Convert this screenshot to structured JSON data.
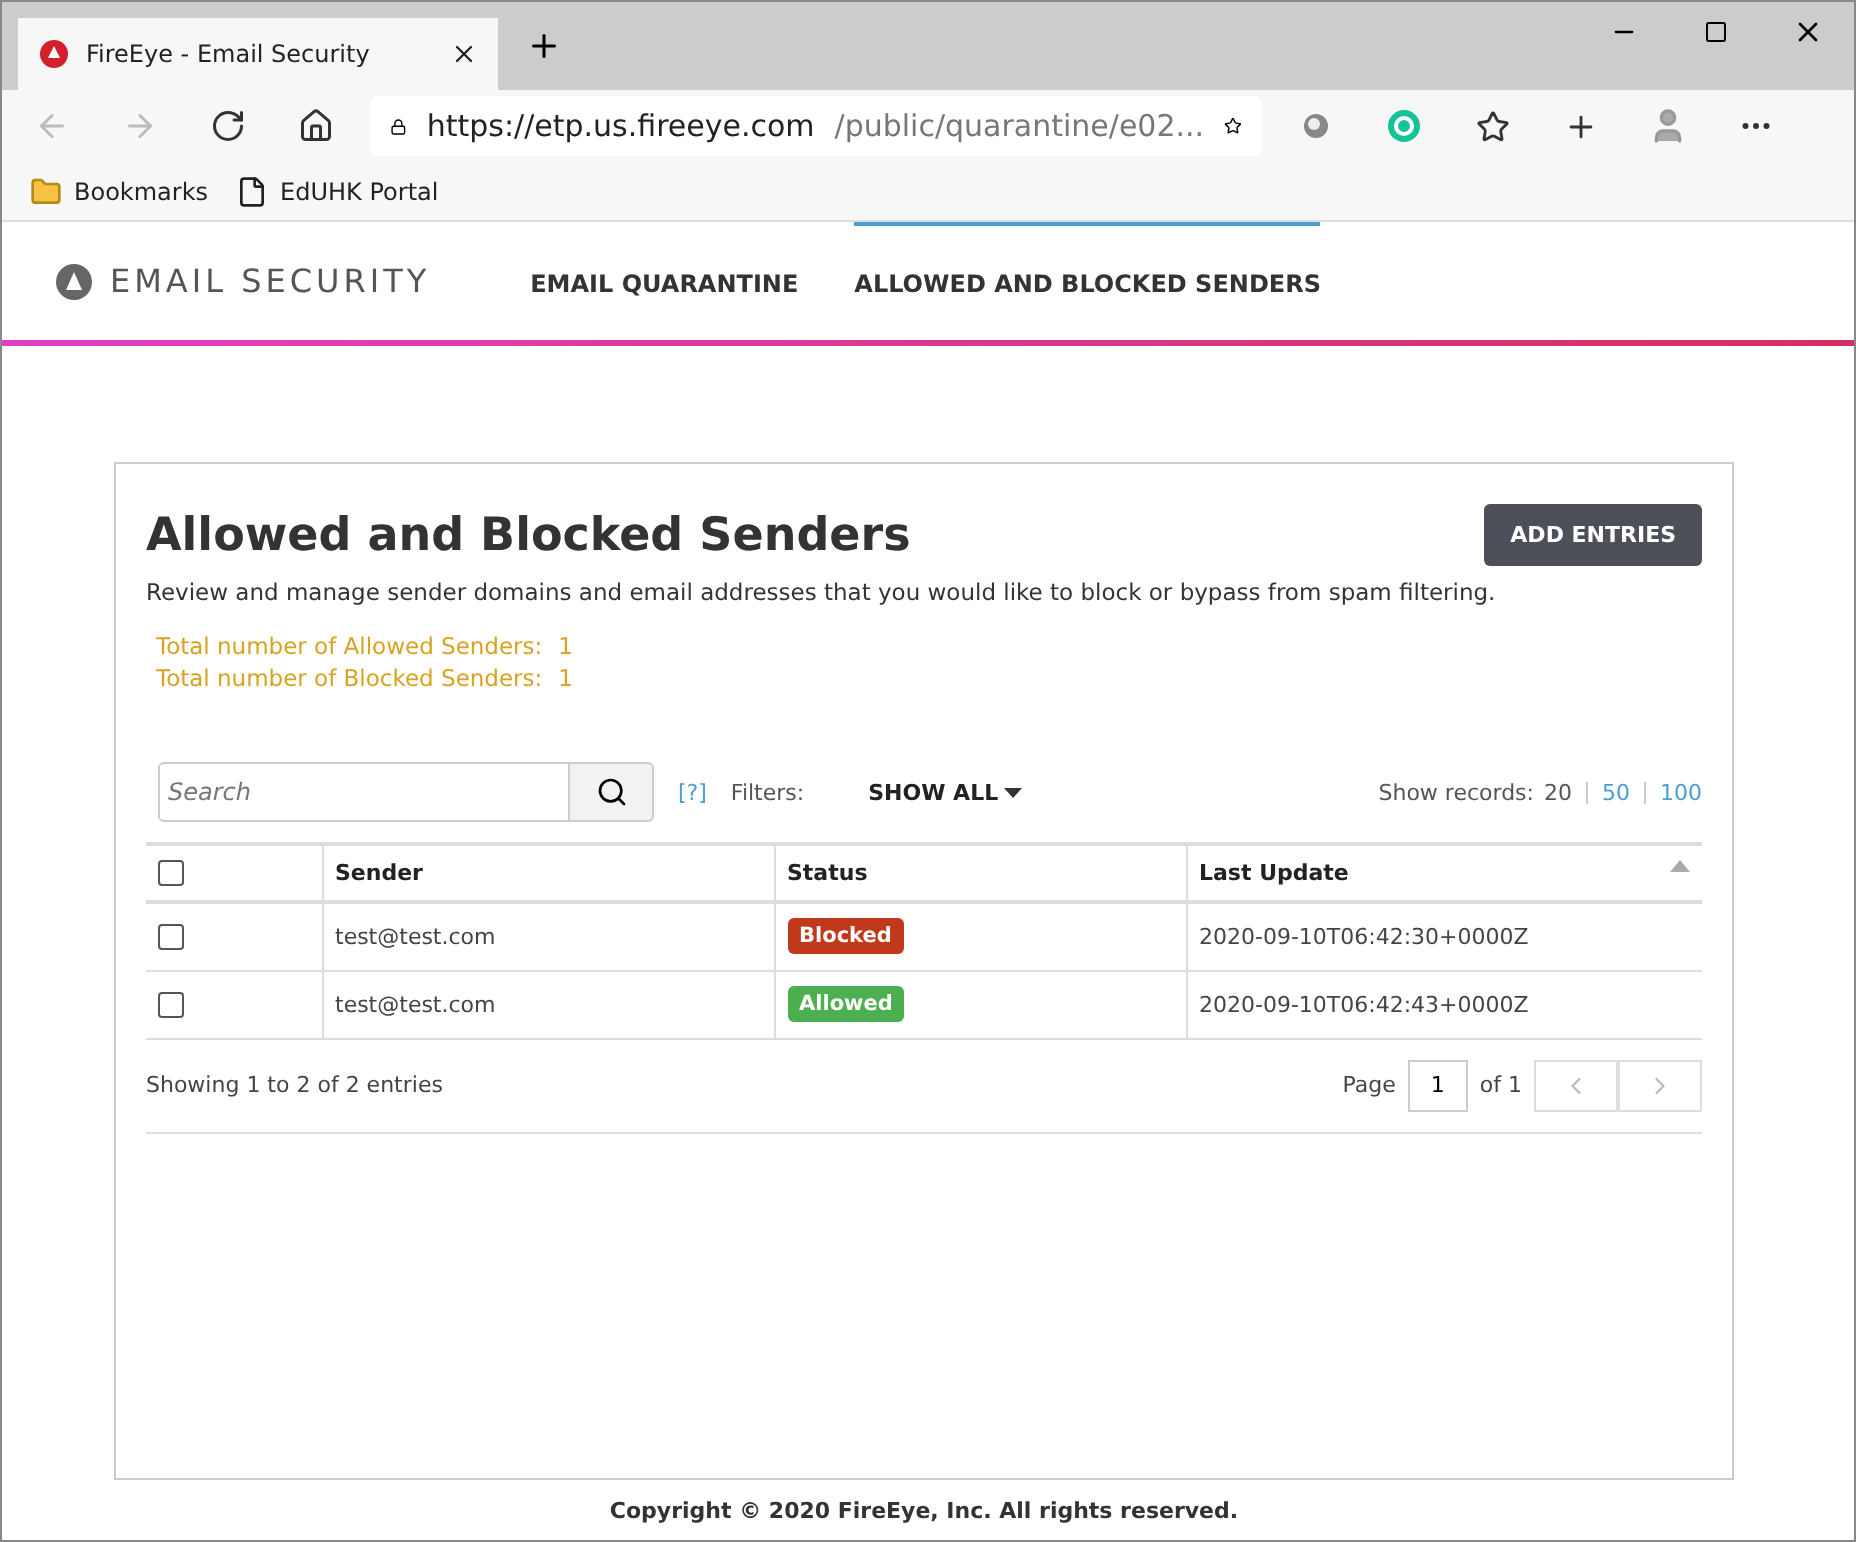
{
  "browser": {
    "tab_title": "FireEye - Email Security",
    "url_host": "https://etp.us.fireeye.com",
    "url_path": "/public/quarantine/e02...",
    "bookmarks": [
      {
        "label": "Bookmarks",
        "kind": "folder"
      },
      {
        "label": "EdUHK Portal",
        "kind": "page"
      }
    ]
  },
  "header": {
    "logo": "EMAIL SECURITY",
    "nav": [
      {
        "label": "EMAIL QUARANTINE",
        "selected": false
      },
      {
        "label": "ALLOWED AND BLOCKED SENDERS",
        "selected": true
      }
    ]
  },
  "panel": {
    "title": "Allowed and Blocked Senders",
    "add_button": "ADD ENTRIES",
    "description": "Review and manage sender domains and email addresses that you would like to block or bypass from spam filtering.",
    "totals": [
      {
        "label": "Total number of Allowed Senders:",
        "value": "1"
      },
      {
        "label": "Total number of Blocked Senders:",
        "value": "1"
      }
    ],
    "search": {
      "placeholder": "Search"
    },
    "help": "[?]",
    "filters_label": "Filters:",
    "filter": "SHOW ALL",
    "records_label": "Show records:",
    "records_options": [
      {
        "label": "20",
        "selected": true
      },
      {
        "label": "50",
        "selected": false
      },
      {
        "label": "100",
        "selected": false
      }
    ],
    "table": {
      "select_all_checked": false,
      "columns": [
        "Sender",
        "Status",
        "Last Update"
      ],
      "rows": [
        {
          "checked": false,
          "sender": "test@test.com",
          "status": {
            "label": "Blocked",
            "kind": "blocked"
          },
          "last_update": "2020-09-10T06:42:30+0000Z"
        },
        {
          "checked": false,
          "sender": "test@test.com",
          "status": {
            "label": "Allowed",
            "kind": "allowed"
          },
          "last_update": "2020-09-10T06:42:43+0000Z"
        }
      ]
    },
    "showing": "Showing 1 to 2 of 2 entries",
    "page_label": "Page",
    "page_value": "1",
    "page_of": "of 1"
  },
  "footer": "Copyright © 2020 FireEye, Inc. All rights reserved."
}
